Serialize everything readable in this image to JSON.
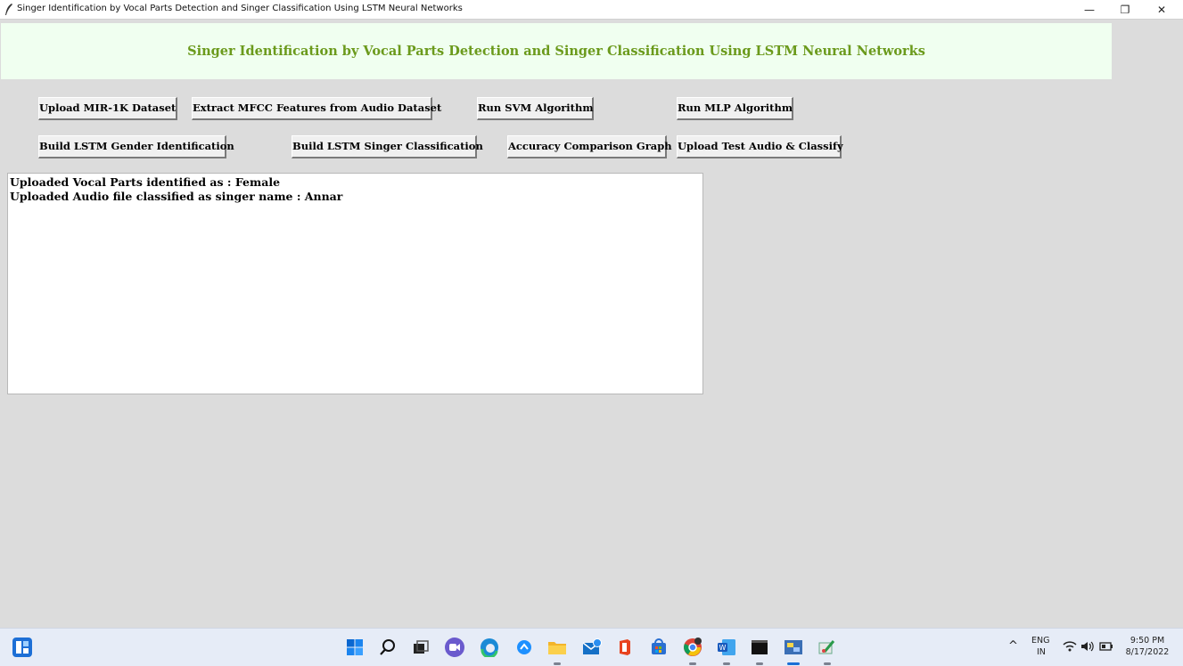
{
  "window": {
    "title": "Singer Identification by Vocal Parts Detection and Singer Classification Using LSTM Neural Networks",
    "minimize_label": "—",
    "maximize_label": "❐",
    "close_label": "✕"
  },
  "header": {
    "title": "Singer Identification by Vocal Parts Detection and Singer Classification Using LSTM Neural Networks",
    "color": "#6b9a1c"
  },
  "buttons": {
    "upload_dataset": "Upload MIR-1K Dataset",
    "extract_mfcc": "Extract MFCC Features from Audio Dataset",
    "run_svm": "Run SVM Algorithm",
    "run_mlp": "Run MLP Algorithm",
    "build_gender": "Build LSTM Gender Identification",
    "build_singer": "Build LSTM Singer Classification",
    "accuracy_graph": "Accuracy Comparison Graph",
    "upload_test": "Upload Test Audio & Classify"
  },
  "output": {
    "lines": [
      "Uploaded Vocal Parts identified as : Female",
      "Uploaded Audio file classified as singer name : Annar"
    ]
  },
  "taskbar": {
    "tray": {
      "language": "ENG",
      "region": "IN",
      "time": "9:50 PM",
      "date": "8/17/2022",
      "chevron": "^"
    },
    "icons": [
      "widgets-icon",
      "start-icon",
      "search-icon",
      "task-view-icon",
      "chat-icon",
      "edge-icon",
      "app-icon",
      "file-explorer-icon",
      "mail-icon",
      "office-icon",
      "store-icon",
      "chrome-icon",
      "word-icon",
      "terminal-icon",
      "python-app-icon",
      "paint-icon"
    ]
  }
}
